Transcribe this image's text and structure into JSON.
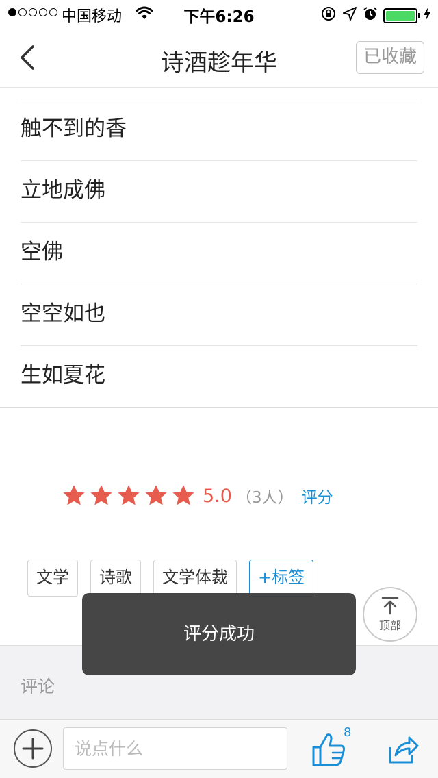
{
  "status_bar": {
    "carrier": "中国移动",
    "time": "下午6:26",
    "signal_dots": 5,
    "signal_strength": 1,
    "battery_level": 1.0
  },
  "nav": {
    "title": "诗酒趁年华",
    "favorite_label": "已收藏"
  },
  "list": {
    "items": [
      "触不到的香",
      "立地成佛",
      "空佛",
      "空空如也",
      "生如夏花"
    ]
  },
  "rating": {
    "stars": 5,
    "score": "5.0",
    "raters": "（3人）",
    "rate_label": "评分",
    "star_color": "#e65c4f"
  },
  "tags": {
    "items": [
      "文学",
      "诗歌",
      "文学体裁"
    ],
    "add_label": "+标签"
  },
  "back_to_top": {
    "label": "顶部"
  },
  "comments": {
    "title": "评论"
  },
  "toast": {
    "message": "评分成功"
  },
  "bottom_bar": {
    "input_placeholder": "说点什么",
    "like_count": "8",
    "accent_color": "#1a8fd8"
  }
}
